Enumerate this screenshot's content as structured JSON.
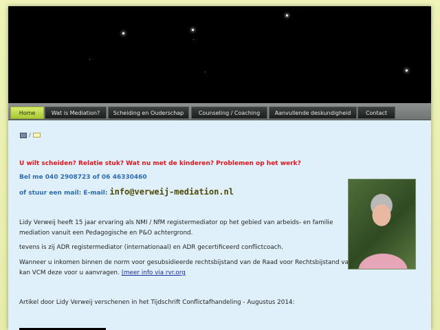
{
  "nav": {
    "items": [
      {
        "label": "Home",
        "active": true
      },
      {
        "label": "Wat is Mediation?",
        "active": false
      },
      {
        "label": "Scheiding en Ouderschap",
        "active": false
      },
      {
        "label": "Counseling / Coaching",
        "active": false
      },
      {
        "label": "Aanvullende deskundigheid",
        "active": false
      },
      {
        "label": "Contact",
        "active": false
      }
    ]
  },
  "tools": {
    "separator": "/"
  },
  "content": {
    "headline": "U wilt scheiden? Relatie stuk? Wat nu met de kinderen? Problemen op het werk?",
    "phone": "Bel me  040 2908723 of 06 46330460",
    "mail_prefix": "of stuur een mail: E-mail:",
    "email": "info@verweij-mediation.nl",
    "para1_line1": "Lidy Verweij heeft 15 jaar ervaring als NMI / NfM registermediator op het gebied van arbeids- en familie",
    "para1_line2": "mediation vanuit een Pedagogische en P&O achtergrond.",
    "para2": "tevens is zij ADR registermediator (internationaal) en ADR gecertificeerd conflictcoach.",
    "para3_line1": "Wanneer u inkomen binnen de norm  voor gesubsidieerde rechtsbijstand van de Raad voor Rechtsbijstand valt,",
    "para3_line2": "kan VCM deze voor u aanvragen. ",
    "para3_link": "(meer info via rvr.org",
    "article": "Artikel door Lidy Verweij verschenen in het Tijdschrift Conflictafhandeling - Augustus 2014:"
  },
  "colors": {
    "active_tab": "#b5d43e",
    "headline": "#e0141b",
    "contact": "#2d6bb3"
  }
}
